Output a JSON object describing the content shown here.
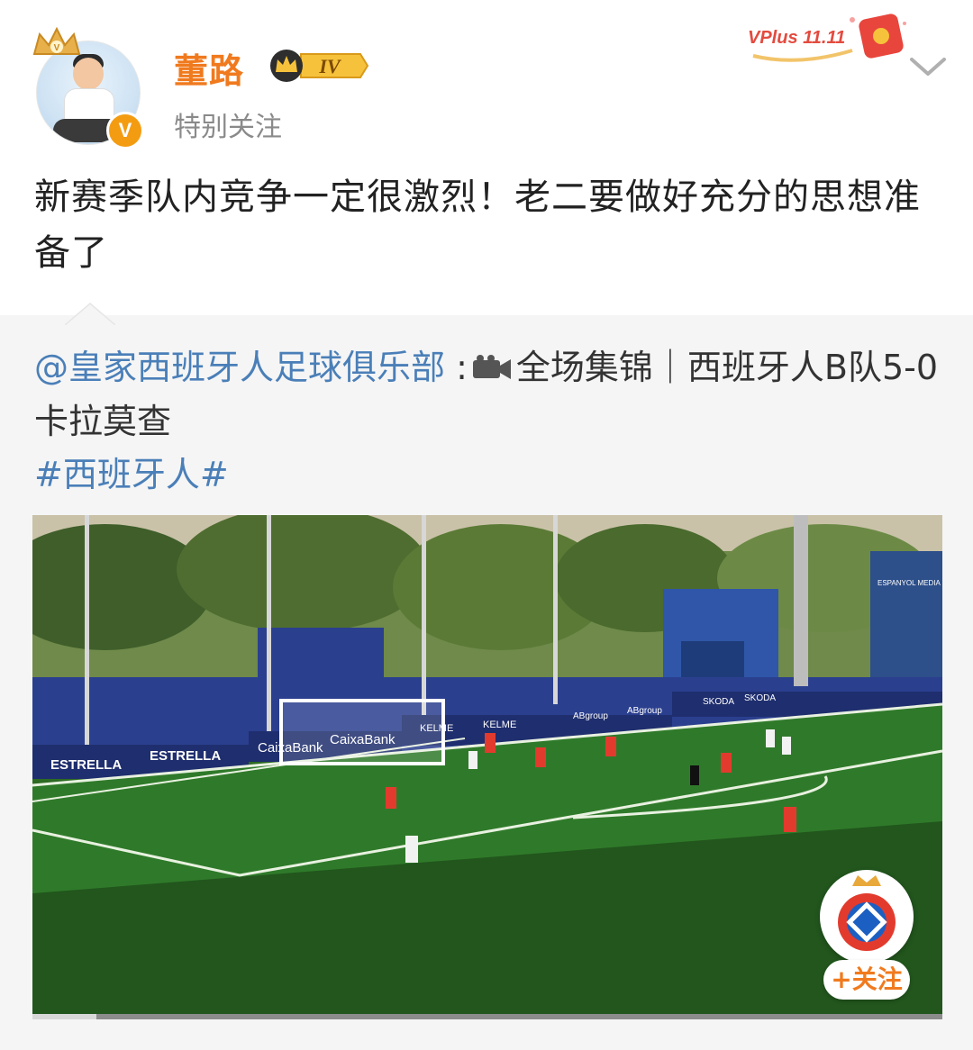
{
  "author": {
    "name": "董路",
    "level_badge": "IV",
    "subtitle": "特别关注",
    "promo_badge": "VPlus 11.11"
  },
  "post": {
    "text": "新赛季队内竞争一定很激烈！老二要做好充分的思想准备了"
  },
  "repost": {
    "mention": "@皇家西班牙人足球俱乐部",
    "separator": " :",
    "title": "全场集锦｜西班牙人B队5-0卡拉莫查",
    "hashtag": "#西班牙人#"
  },
  "video": {
    "progress_percent": 7,
    "follow_label": "+关注",
    "pitch_signage": [
      "ESTRELLA",
      "ESTRELLA",
      "CaixaBank",
      "CaixaBank",
      "KELME",
      "KELME",
      "ABgroup",
      "ABgroup",
      "SKODA",
      "SKODA",
      "ESPANYOL MEDIA"
    ]
  },
  "colors": {
    "author_name": "#f07a1e",
    "link": "#4a7fb8",
    "repost_bg": "#f5f5f5",
    "pitch": "#2f7a2a"
  }
}
